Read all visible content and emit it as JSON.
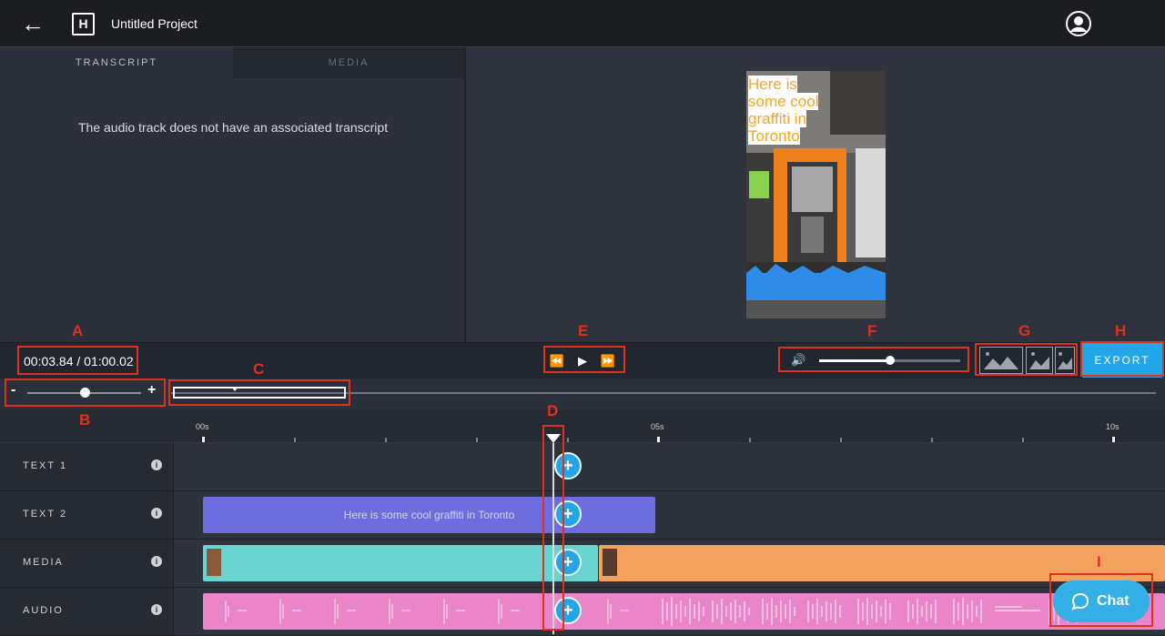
{
  "header": {
    "title": "Untitled Project",
    "back_icon": "back-arrow-icon",
    "logo_icon": "app-logo-icon",
    "avatar_icon": "user-avatar-icon"
  },
  "left_panel": {
    "tabs": [
      {
        "label": "TRANSCRIPT",
        "active": true
      },
      {
        "label": "MEDIA",
        "active": false
      }
    ],
    "message": "The audio track does not have an associated transcript"
  },
  "preview": {
    "overlay_lines": [
      "Here is",
      "some cool",
      "graffiti in",
      "Toronto"
    ],
    "overlay_color": "#f5a623"
  },
  "controls": {
    "timecode": "00:03.84 / 01:00.02",
    "volume_level": 0.5,
    "export_label": "EXPORT",
    "accent_color": "#23a6e8"
  },
  "zoom": {
    "minus": "-",
    "plus": "+",
    "level": 0.5
  },
  "ruler": {
    "labels": [
      "00s",
      "05s",
      "10s"
    ]
  },
  "tracks": [
    {
      "name": "TEXT 1"
    },
    {
      "name": "TEXT 2",
      "clip_text": "Here is some cool graffiti in Toronto"
    },
    {
      "name": "MEDIA"
    },
    {
      "name": "AUDIO"
    }
  ],
  "annotations": [
    "A",
    "B",
    "C",
    "D",
    "E",
    "F",
    "G",
    "H",
    "I"
  ],
  "chat": {
    "label": "Chat"
  }
}
